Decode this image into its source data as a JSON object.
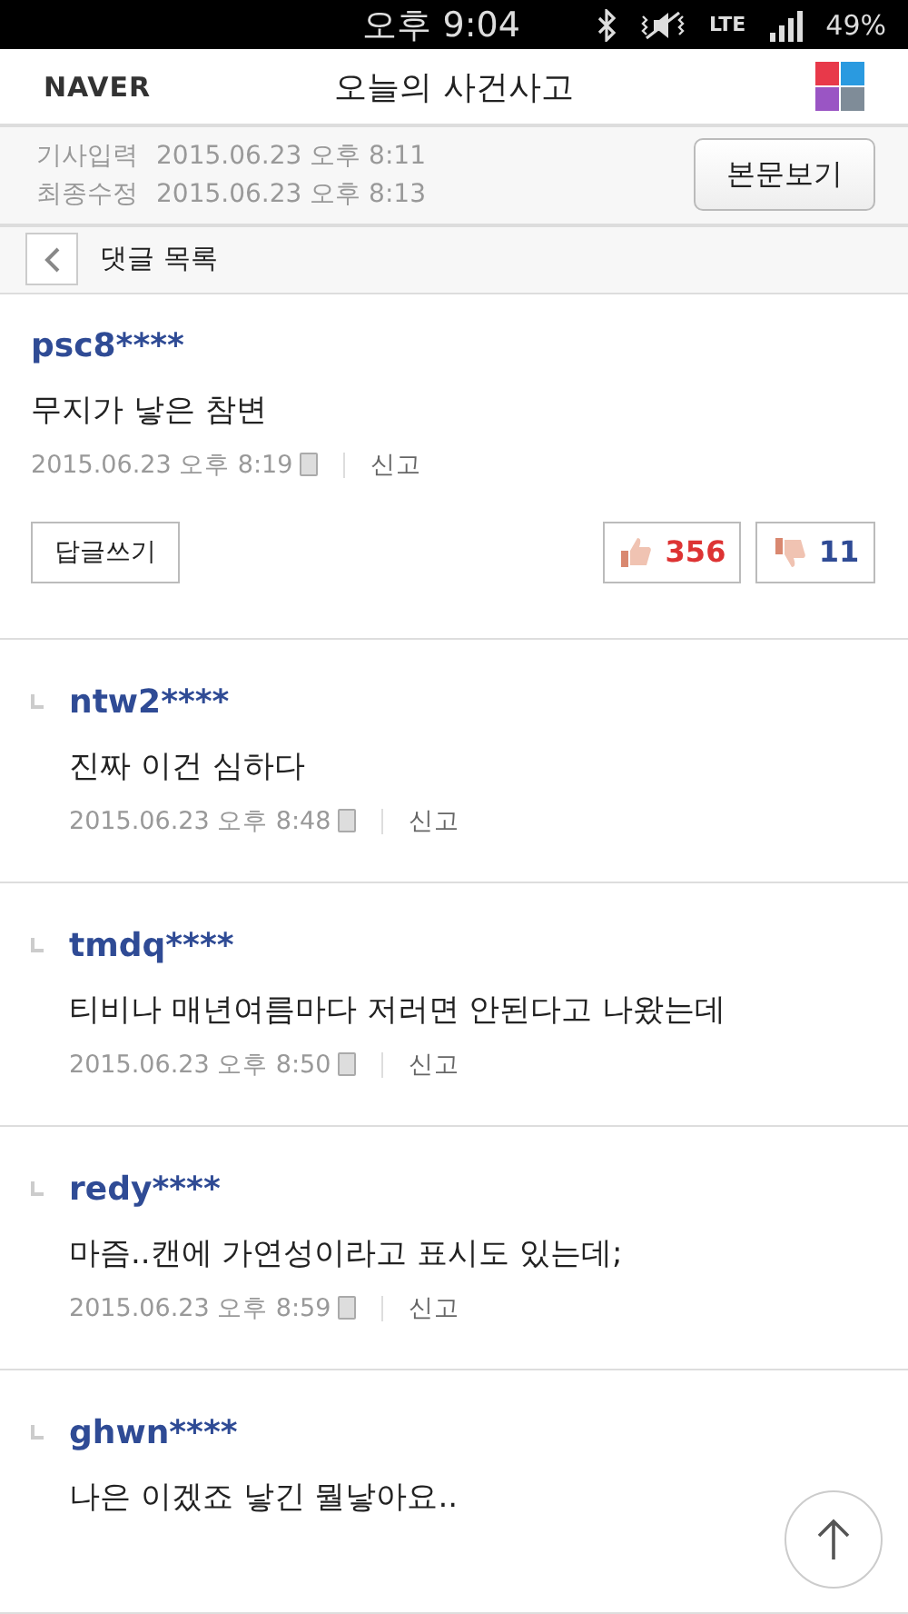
{
  "status_bar": {
    "time": "오후 9:04",
    "network": "LTE",
    "battery": "49%"
  },
  "header": {
    "logo": "NAVER",
    "title": "오늘의 사건사고"
  },
  "article_info": {
    "rows": [
      {
        "label": "기사입력",
        "value": "2015.06.23 오후 8:11"
      },
      {
        "label": "최종수정",
        "value": "2015.06.23 오후 8:13"
      }
    ],
    "button": "본문보기"
  },
  "comment_bar": {
    "title": "댓글 목록"
  },
  "comments": [
    {
      "kind": "comment",
      "user": "psc8****",
      "text": "무지가 낳은 참변",
      "date": "2015.06.23 오후 8:19",
      "report": "신고",
      "reply_button": "답글쓰기",
      "likes": "356",
      "dislikes": "11"
    },
    {
      "kind": "reply",
      "user": "ntw2****",
      "text": "진짜 이건 심하다",
      "date": "2015.06.23 오후 8:48",
      "report": "신고"
    },
    {
      "kind": "reply",
      "user": "tmdq****",
      "text": "티비나 매년여름마다 저러면 안된다고 나왔는데",
      "date": "2015.06.23 오후 8:50",
      "report": "신고"
    },
    {
      "kind": "reply",
      "user": "redy****",
      "text": "마즘..캔에 가연성이라고 표시도 있는데;",
      "date": "2015.06.23 오후 8:59",
      "report": "신고"
    },
    {
      "kind": "reply",
      "user": "ghwn****",
      "text": "나은 이겠죠 낳긴 뭘낳아요.."
    }
  ]
}
